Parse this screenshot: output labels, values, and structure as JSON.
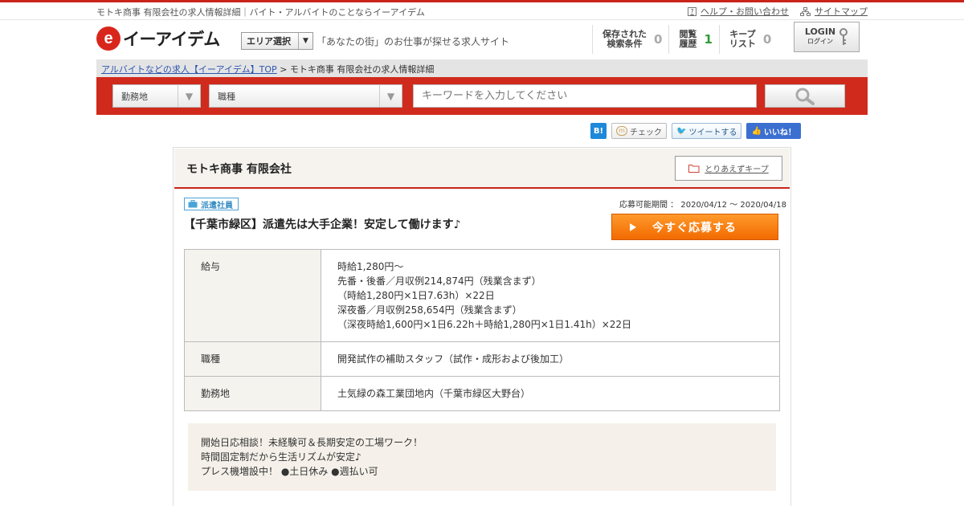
{
  "topbar": {
    "site_desc": "モトキ商事 有限会社の求人情報詳細｜バイト・アルバイトのことならイーアイデム",
    "help_label": "ヘルプ・お問い合わせ",
    "sitemap_label": "サイトマップ"
  },
  "header": {
    "logo_mark": "e",
    "logo_text": "イーアイデム",
    "area_select_label": "エリア選択",
    "tagline": "「あなたの街」のお仕事が探せる求人サイト",
    "stats": [
      {
        "line1": "保存された",
        "line2": "検索条件",
        "value": "0"
      },
      {
        "line1": "閲覧",
        "line2": "履歴",
        "value": "1"
      },
      {
        "line1": "キープ",
        "line2": "リスト",
        "value": "0"
      }
    ],
    "login_label": "LOGIN",
    "login_sub": "ログイン"
  },
  "breadcrumb": {
    "home_link": "アルバイトなどの求人【イーアイデム】TOP",
    "separator": " > ",
    "current": "モトキ商事 有限会社の求人情報詳細"
  },
  "search": {
    "location_label": "勤務地",
    "jobtype_label": "職種",
    "keyword_placeholder": "キーワードを入力してください"
  },
  "social": {
    "hatena": "B!",
    "check": "チェック",
    "tweet": "ツイートする",
    "like": "いいね！"
  },
  "job": {
    "company": "モトキ商事 有限会社",
    "keep_label": "とりあえずキープ",
    "employment_type": "派遣社員",
    "period": "応募可能期間 ： 2020/04/12 ～ 2020/04/18",
    "title": "【千葉市緑区】派遣先は大手企業！安定して働けます♪",
    "apply_label": "今すぐ応募する",
    "details": [
      {
        "label": "給与",
        "lines": [
          "時給1,280円〜",
          "先番・後番／月収例214,874円（残業含まず）",
          "（時給1,280円×1日7.63h）×22日",
          "深夜番／月収例258,654円（残業含まず）",
          "（深夜時給1,600円×1日6.22h＋時給1,280円×1日1.41h）×22日"
        ]
      },
      {
        "label": "職種",
        "lines": [
          "開発試作の補助スタッフ（試作・成形および後加工）"
        ]
      },
      {
        "label": "勤務地",
        "lines": [
          "土気緑の森工業団地内（千葉市緑区大野台）"
        ]
      }
    ],
    "description": [
      "開始日応相談！未経験可＆長期安定の工場ワーク！",
      "時間固定制だから生活リズムが安定♪",
      "プレス機増設中！ ●土日休み ●週払い可"
    ]
  },
  "colors": {
    "brand_red": "#d02a1c",
    "apply_orange": "#f26a00",
    "badge_blue": "#3a8fc4"
  }
}
